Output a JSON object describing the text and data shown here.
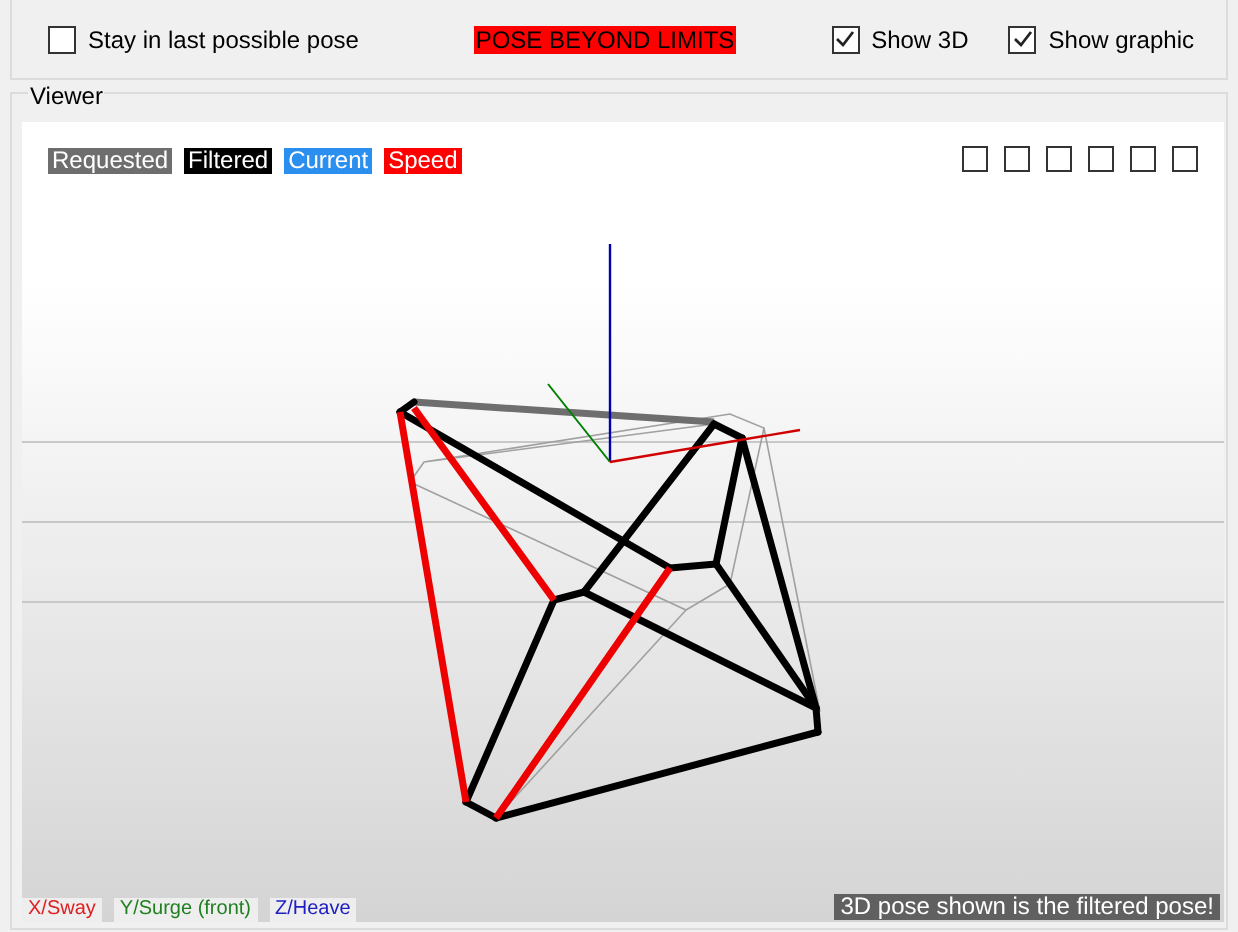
{
  "options": [
    {
      "label": "Stay in last possible pose",
      "checked": false
    }
  ],
  "status": "POSE BEYOND LIMITS",
  "toggles": [
    {
      "label": "Show 3D",
      "checked": true
    },
    {
      "label": "Show graphic",
      "checked": true
    }
  ],
  "viewer": {
    "title": "Viewer",
    "legend": [
      {
        "label": "Requested",
        "color": "#6e6e6e"
      },
      {
        "label": "Filtered",
        "color": "#000000"
      },
      {
        "label": "Current",
        "color": "#2b8ff0"
      },
      {
        "label": "Speed",
        "color": "#ff0000"
      }
    ],
    "view_buttons": [
      {
        "checked": false
      },
      {
        "checked": false
      },
      {
        "checked": false
      },
      {
        "checked": false
      },
      {
        "checked": false
      },
      {
        "checked": false
      }
    ],
    "axis_labels": [
      {
        "label": "X/Sway",
        "color": "#e02020"
      },
      {
        "label": "Y/Surge (front)",
        "color": "#208020"
      },
      {
        "label": "Z/Heave",
        "color": "#2020c0"
      }
    ],
    "note": "3D pose shown is the filtered pose!"
  }
}
